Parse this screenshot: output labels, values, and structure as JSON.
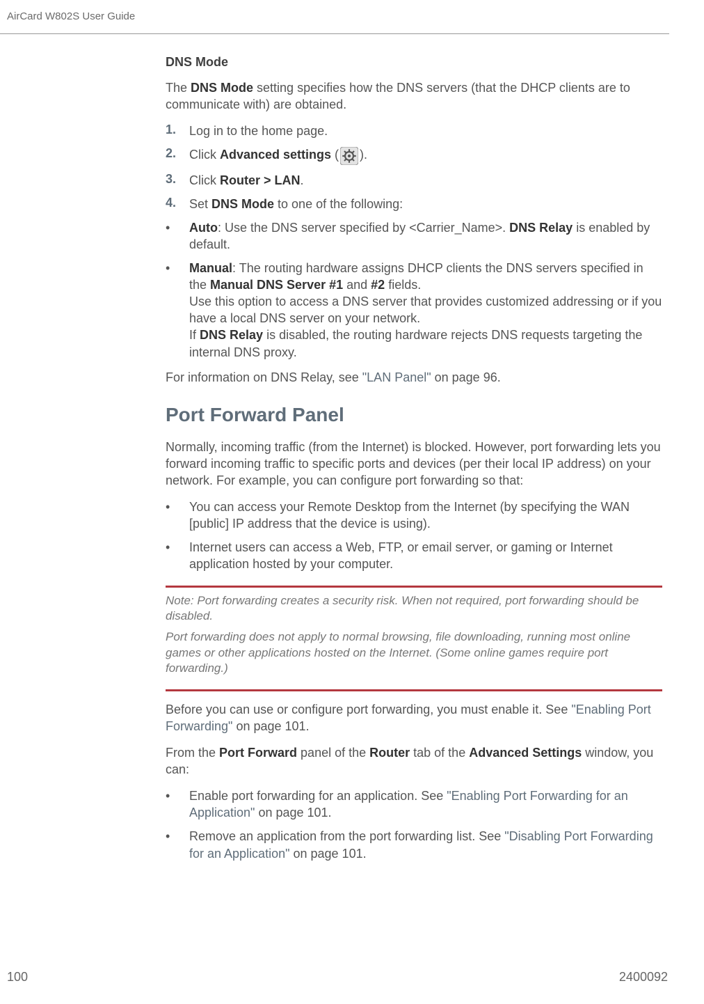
{
  "header": {
    "running_title": "AirCard W802S User Guide"
  },
  "section_dns": {
    "title": "DNS Mode",
    "para1_pre": "The ",
    "dns_mode_b": "DNS Mode",
    "para1_post": " setting specifies how the DNS servers (that the DHCP clients are to communicate with) are obtained.",
    "steps": {
      "n1": "1.",
      "t1": "Log in to the home page.",
      "n2": "2.",
      "t2_pre": "Click ",
      "t2_b": "Advanced settings",
      "t2_post": " (",
      "t2_end": ").",
      "n3": "3.",
      "t3_pre": "Click ",
      "t3_b": "Router > LAN",
      "t3_post": ".",
      "n4": "4.",
      "t4_pre": "Set ",
      "t4_b": "DNS Mode",
      "t4_post": " to one of the following:"
    },
    "bullets": {
      "b1_bold": "Auto",
      "b1_text_a": ": Use the DNS server specified by <Carrier_Name>. ",
      "b1_bold2": "DNS Relay",
      "b1_text_b": " is enabled by default.",
      "b2_bold": "Manual",
      "b2_text_a": ": The routing hardware assigns DHCP clients the DNS servers specified in the ",
      "b2_bold2": "Manual DNS Server #1",
      "b2_text_b": " and ",
      "b2_bold3": "#2",
      "b2_text_c": " fields.",
      "b2_line2": "Use this option to access a DNS server that provides customized addressing or if you have a local DNS server on your network.",
      "b2_line3_pre": "If ",
      "b2_line3_b": "DNS Relay",
      "b2_line3_post": " is disabled, the routing hardware rejects DNS requests targeting the internal DNS proxy."
    },
    "after_pre": "For information on DNS Relay, see ",
    "after_link": "\"LAN Panel\"",
    "after_post": " on page 96."
  },
  "section_pf": {
    "title": "Port Forward Panel",
    "intro": "Normally, incoming traffic (from the Internet) is blocked. However, port forwarding lets you forward incoming traffic to specific ports and devices (per their local IP address) on your network. For example, you can configure port forwarding so that:",
    "b1": "You can access your Remote Desktop from the Internet (by specifying the WAN [public] IP address that the device is using).",
    "b2": "Internet users can access a Web, FTP, or email server, or gaming or Internet application hosted by your computer.",
    "note1_pre": "Note:  ",
    "note1": "Port forwarding creates a security risk. When not required, port forwarding should be disabled.",
    "note2": "Port forwarding does not apply to normal browsing, file downloading, running most online games or other applications hosted on the Internet. (Some online games require port forwarding.)",
    "before_pre": "Before you can use or configure port forwarding, you must enable it. See ",
    "before_link": "\"Enabling Port Forwarding\"",
    "before_post": " on page 101.",
    "from_pre": "From the ",
    "from_b1": "Port Forward",
    "from_mid1": " panel of the ",
    "from_b2": "Router",
    "from_mid2": " tab of the ",
    "from_b3": "Advanced Settings",
    "from_post": " window, you can:",
    "cb1_pre": "Enable port forwarding for an application. See ",
    "cb1_link": "\"Enabling Port Forwarding for an Application\"",
    "cb1_post": " on page 101.",
    "cb2_pre": "Remove an application from the port forwarding list. See ",
    "cb2_link": "\"Disabling Port Forwarding for an Application\"",
    "cb2_post": " on page 101."
  },
  "footer": {
    "page": "100",
    "docnum": "2400092"
  },
  "glyphs": {
    "bullet": "•"
  }
}
